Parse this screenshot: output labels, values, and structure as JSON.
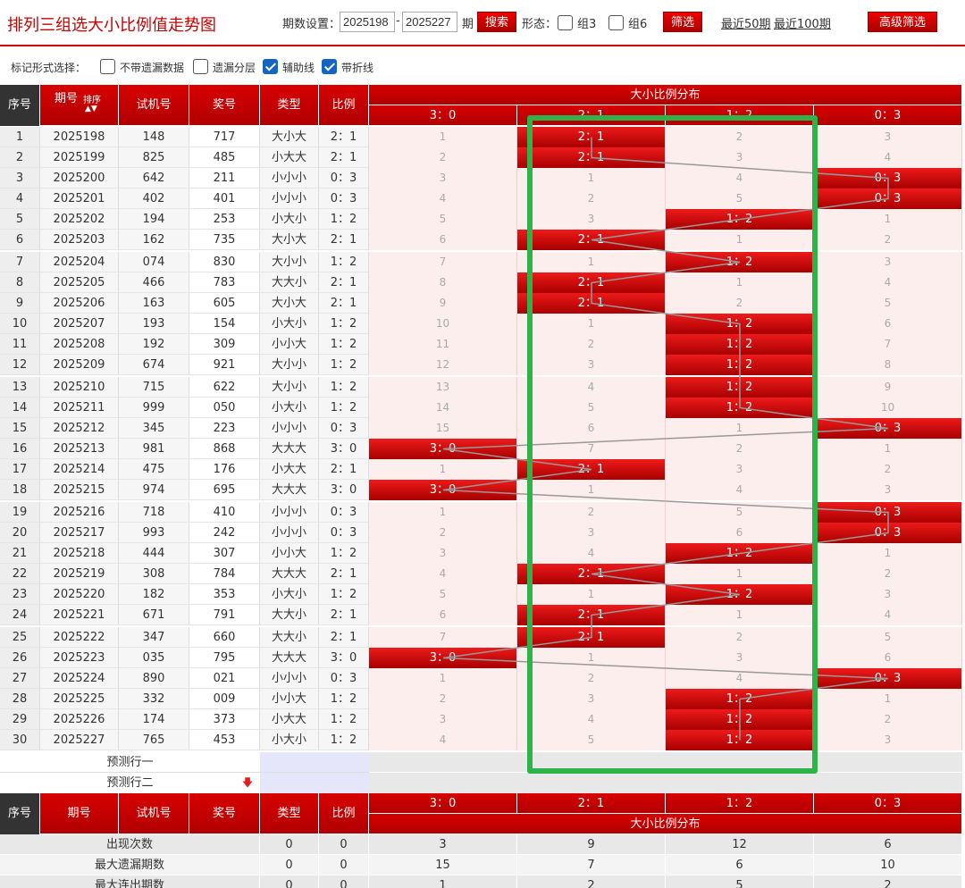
{
  "header": {
    "title": "排列三组选大小比例值走势图",
    "period_label": "期数设置：",
    "from": "2025198",
    "dash": "-",
    "to": "2025227",
    "period_unit": "期",
    "search": "搜索",
    "shape_label": "形态：",
    "group3": "组3",
    "group6": "组6",
    "filter": "筛选",
    "recent50": "最近50期",
    "recent100": "最近100期",
    "advanced": "高级筛选"
  },
  "options": {
    "label": "标记形式选择：",
    "items": [
      {
        "label": "不带遗漏数据",
        "checked": false
      },
      {
        "label": "遗漏分层",
        "checked": false
      },
      {
        "label": "辅助线",
        "checked": true
      },
      {
        "label": "带折线",
        "checked": true
      }
    ]
  },
  "table_header": {
    "seq": "序号",
    "period": "期号",
    "sort": "排序",
    "test": "试机号",
    "prize": "奖号",
    "type": "类型",
    "ratio": "比例",
    "group": "大小比例分布",
    "cols": [
      "3：0",
      "2：1",
      "1：2",
      "0：3"
    ]
  },
  "rows": [
    {
      "n": "1",
      "period": "2025198",
      "test": "148",
      "prize": "717",
      "type": "大小大",
      "ratio": "2：1",
      "hit": 1,
      "miss": [
        "1",
        "",
        "2",
        "3"
      ]
    },
    {
      "n": "2",
      "period": "2025199",
      "test": "825",
      "prize": "485",
      "type": "小大大",
      "ratio": "2：1",
      "hit": 1,
      "miss": [
        "2",
        "",
        "3",
        "4"
      ]
    },
    {
      "n": "3",
      "period": "2025200",
      "test": "642",
      "prize": "211",
      "type": "小小小",
      "ratio": "0：3",
      "hit": 3,
      "miss": [
        "3",
        "1",
        "4",
        ""
      ]
    },
    {
      "n": "4",
      "period": "2025201",
      "test": "402",
      "prize": "401",
      "type": "小小小",
      "ratio": "0：3",
      "hit": 3,
      "miss": [
        "4",
        "2",
        "5",
        ""
      ]
    },
    {
      "n": "5",
      "period": "2025202",
      "test": "194",
      "prize": "253",
      "type": "小大小",
      "ratio": "1：2",
      "hit": 2,
      "miss": [
        "5",
        "3",
        "",
        "1"
      ]
    },
    {
      "n": "6",
      "period": "2025203",
      "test": "162",
      "prize": "735",
      "type": "大小大",
      "ratio": "2：1",
      "hit": 1,
      "miss": [
        "6",
        "",
        "1",
        "2"
      ]
    },
    {
      "n": "7",
      "period": "2025204",
      "test": "074",
      "prize": "830",
      "type": "大小小",
      "ratio": "1：2",
      "hit": 2,
      "miss": [
        "7",
        "1",
        "",
        "3"
      ]
    },
    {
      "n": "8",
      "period": "2025205",
      "test": "466",
      "prize": "783",
      "type": "大大小",
      "ratio": "2：1",
      "hit": 1,
      "miss": [
        "8",
        "",
        "1",
        "4"
      ]
    },
    {
      "n": "9",
      "period": "2025206",
      "test": "163",
      "prize": "605",
      "type": "大小大",
      "ratio": "2：1",
      "hit": 1,
      "miss": [
        "9",
        "",
        "2",
        "5"
      ]
    },
    {
      "n": "10",
      "period": "2025207",
      "test": "193",
      "prize": "154",
      "type": "小大小",
      "ratio": "1：2",
      "hit": 2,
      "miss": [
        "10",
        "1",
        "",
        "6"
      ]
    },
    {
      "n": "11",
      "period": "2025208",
      "test": "192",
      "prize": "309",
      "type": "小小大",
      "ratio": "1：2",
      "hit": 2,
      "miss": [
        "11",
        "2",
        "",
        "7"
      ]
    },
    {
      "n": "12",
      "period": "2025209",
      "test": "674",
      "prize": "921",
      "type": "大小小",
      "ratio": "1：2",
      "hit": 2,
      "miss": [
        "12",
        "3",
        "",
        "8"
      ]
    },
    {
      "n": "13",
      "period": "2025210",
      "test": "715",
      "prize": "622",
      "type": "大小小",
      "ratio": "1：2",
      "hit": 2,
      "miss": [
        "13",
        "4",
        "",
        "9"
      ]
    },
    {
      "n": "14",
      "period": "2025211",
      "test": "999",
      "prize": "050",
      "type": "小大小",
      "ratio": "1：2",
      "hit": 2,
      "miss": [
        "14",
        "5",
        "",
        "10"
      ]
    },
    {
      "n": "15",
      "period": "2025212",
      "test": "345",
      "prize": "223",
      "type": "小小小",
      "ratio": "0：3",
      "hit": 3,
      "miss": [
        "15",
        "6",
        "1",
        ""
      ]
    },
    {
      "n": "16",
      "period": "2025213",
      "test": "981",
      "prize": "868",
      "type": "大大大",
      "ratio": "3：0",
      "hit": 0,
      "miss": [
        "",
        "7",
        "2",
        "1"
      ]
    },
    {
      "n": "17",
      "period": "2025214",
      "test": "475",
      "prize": "176",
      "type": "小大大",
      "ratio": "2：1",
      "hit": 1,
      "miss": [
        "1",
        "",
        "3",
        "2"
      ]
    },
    {
      "n": "18",
      "period": "2025215",
      "test": "974",
      "prize": "695",
      "type": "大大大",
      "ratio": "3：0",
      "hit": 0,
      "miss": [
        "",
        "1",
        "4",
        "3"
      ]
    },
    {
      "n": "19",
      "period": "2025216",
      "test": "718",
      "prize": "410",
      "type": "小小小",
      "ratio": "0：3",
      "hit": 3,
      "miss": [
        "1",
        "2",
        "5",
        ""
      ]
    },
    {
      "n": "20",
      "period": "2025217",
      "test": "993",
      "prize": "242",
      "type": "小小小",
      "ratio": "0：3",
      "hit": 3,
      "miss": [
        "2",
        "3",
        "6",
        ""
      ]
    },
    {
      "n": "21",
      "period": "2025218",
      "test": "444",
      "prize": "307",
      "type": "小小大",
      "ratio": "1：2",
      "hit": 2,
      "miss": [
        "3",
        "4",
        "",
        "1"
      ]
    },
    {
      "n": "22",
      "period": "2025219",
      "test": "308",
      "prize": "784",
      "type": "大大大",
      "ratio": "2：1",
      "hit": 1,
      "miss": [
        "4",
        "",
        "1",
        "2"
      ]
    },
    {
      "n": "23",
      "period": "2025220",
      "test": "182",
      "prize": "353",
      "type": "小大小",
      "ratio": "1：2",
      "hit": 2,
      "miss": [
        "5",
        "1",
        "",
        "3"
      ]
    },
    {
      "n": "24",
      "period": "2025221",
      "test": "671",
      "prize": "791",
      "type": "大大小",
      "ratio": "2：1",
      "hit": 1,
      "miss": [
        "6",
        "",
        "1",
        "4"
      ]
    },
    {
      "n": "25",
      "period": "2025222",
      "test": "347",
      "prize": "660",
      "type": "大大小",
      "ratio": "2：1",
      "hit": 1,
      "miss": [
        "7",
        "",
        "2",
        "5"
      ]
    },
    {
      "n": "26",
      "period": "2025223",
      "test": "035",
      "prize": "795",
      "type": "大大大",
      "ratio": "3：0",
      "hit": 0,
      "miss": [
        "",
        "1",
        "3",
        "6"
      ]
    },
    {
      "n": "27",
      "period": "2025224",
      "test": "890",
      "prize": "021",
      "type": "小小小",
      "ratio": "0：3",
      "hit": 3,
      "miss": [
        "1",
        "2",
        "4",
        ""
      ]
    },
    {
      "n": "28",
      "period": "2025225",
      "test": "332",
      "prize": "009",
      "type": "小小大",
      "ratio": "1：2",
      "hit": 2,
      "miss": [
        "2",
        "3",
        "",
        "1"
      ]
    },
    {
      "n": "29",
      "period": "2025226",
      "test": "174",
      "prize": "373",
      "type": "小大大",
      "ratio": "1：2",
      "hit": 2,
      "miss": [
        "3",
        "4",
        "",
        "2"
      ]
    },
    {
      "n": "30",
      "period": "2025227",
      "test": "765",
      "prize": "453",
      "type": "小大小",
      "ratio": "1：2",
      "hit": 2,
      "miss": [
        "4",
        "5",
        "",
        "3"
      ]
    }
  ],
  "predict": {
    "row1": "预测行一",
    "row2": "预测行二"
  },
  "stats": [
    {
      "label": "出现次数",
      "type": "0",
      "ratio": "0",
      "vals": [
        "3",
        "9",
        "12",
        "6"
      ]
    },
    {
      "label": "最大遗漏期数",
      "type": "0",
      "ratio": "0",
      "vals": [
        "15",
        "7",
        "6",
        "10"
      ]
    },
    {
      "label": "最大连出期数",
      "type": "0",
      "ratio": "0",
      "vals": [
        "1",
        "2",
        "5",
        "2"
      ]
    }
  ],
  "colors": {
    "accent": "#c70000",
    "highlight": "#2eb34a",
    "odd_row": "#ffeef0"
  }
}
